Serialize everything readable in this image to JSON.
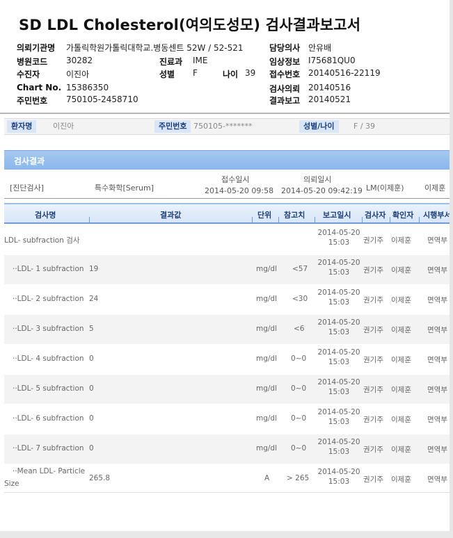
{
  "title": "SD LDL Cholesterol(여의도성모) 검사결과보고서",
  "header": {
    "inst_label": "의뢰기관명",
    "inst_value": "가톨릭학원가톨릭대학교.병동센트 52W / 52-521",
    "doctor_label": "담당의사",
    "doctor_value": "안유배",
    "hosp_code_label": "병원코드",
    "hosp_code_value": "30282",
    "dept_label": "진료과",
    "dept_value": "IME",
    "clinical_label": "임상정보",
    "clinical_value": "I75681QU0",
    "receiver_label": "수진자",
    "receiver_value": "이진아",
    "sex_label": "성별",
    "sex_value": "F",
    "age_label": "나이",
    "age_value": "39",
    "accept_no_label": "접수번호",
    "accept_no_value": "20140516-22119",
    "chart_label": "Chart No.",
    "chart_value": "15386350",
    "request_label": "검사의뢰",
    "request_value": "20140516",
    "id_label": "주민번호",
    "id_value": "750105-2458710",
    "report_label": "결과보고",
    "report_value": "20140521"
  },
  "patient_bar": {
    "name_label": "환자명",
    "name_value": "이진아",
    "id_label": "주민번호",
    "id_value": "750105-*******",
    "sexage_label": "성별/나이",
    "sexage_value": "F / 39"
  },
  "section_title": "검사결과",
  "info": {
    "diag": "[진단검사]",
    "specimen": "특수화학[Serum]",
    "accept_label": "접수일시",
    "accept_value": "2014-05-20 09:58",
    "request_label": "의뢰일시",
    "request_value": "2014-05-20 09:42:19",
    "lm": "LM(이제훈)",
    "doctor": "이제훈"
  },
  "table": {
    "headers": [
      "검사명",
      "결과값",
      "단위",
      "참고치",
      "보고일시",
      "검사자",
      "확인자",
      "시행부서"
    ],
    "rows": [
      {
        "name": "LDL- subfraction 검사",
        "name2": "",
        "value": "",
        "unit": "",
        "ref": "",
        "date": "2014-05-20",
        "time": "15:03",
        "tester": "권기주",
        "checker": "이제훈",
        "dept": "면역부"
      },
      {
        "name": "··LDL- 1 subfraction",
        "name2": "",
        "value": "19",
        "unit": "mg/dl",
        "ref": "<57",
        "date": "2014-05-20",
        "time": "15:03",
        "tester": "권기주",
        "checker": "이제훈",
        "dept": "면역부"
      },
      {
        "name": "··LDL- 2 subfraction",
        "name2": "",
        "value": "24",
        "unit": "mg/dl",
        "ref": "<30",
        "date": "2014-05-20",
        "time": "15:03",
        "tester": "권기주",
        "checker": "이제훈",
        "dept": "면역부"
      },
      {
        "name": "··LDL- 3 subfraction",
        "name2": "",
        "value": "5",
        "unit": "mg/dl",
        "ref": "<6",
        "date": "2014-05-20",
        "time": "15:03",
        "tester": "권기주",
        "checker": "이제훈",
        "dept": "면역부"
      },
      {
        "name": "··LDL- 4 subfraction",
        "name2": "",
        "value": "0",
        "unit": "mg/dl",
        "ref": "0~0",
        "date": "2014-05-20",
        "time": "15:03",
        "tester": "권기주",
        "checker": "이제훈",
        "dept": "면역부"
      },
      {
        "name": "··LDL- 5 subfraction",
        "name2": "",
        "value": "0",
        "unit": "mg/dl",
        "ref": "0~0",
        "date": "2014-05-20",
        "time": "15:03",
        "tester": "권기주",
        "checker": "이제훈",
        "dept": "면역부"
      },
      {
        "name": "··LDL- 6 subfraction",
        "name2": "",
        "value": "0",
        "unit": "mg/dl",
        "ref": "0~0",
        "date": "2014-05-20",
        "time": "15:03",
        "tester": "권기주",
        "checker": "이제훈",
        "dept": "면역부"
      },
      {
        "name": "··LDL- 7 subfraction",
        "name2": "",
        "value": "0",
        "unit": "mg/dl",
        "ref": "0~0",
        "date": "2014-05-20",
        "time": "15:03",
        "tester": "권기주",
        "checker": "이제훈",
        "dept": "면역부"
      },
      {
        "name": "··Mean LDL- Particle",
        "name2": "Size",
        "value": "265.8",
        "unit": "A",
        "ref": "> 265",
        "date": "2014-05-20",
        "time": "15:03",
        "tester": "권기주",
        "checker": "이제훈",
        "dept": "면역부"
      }
    ]
  }
}
